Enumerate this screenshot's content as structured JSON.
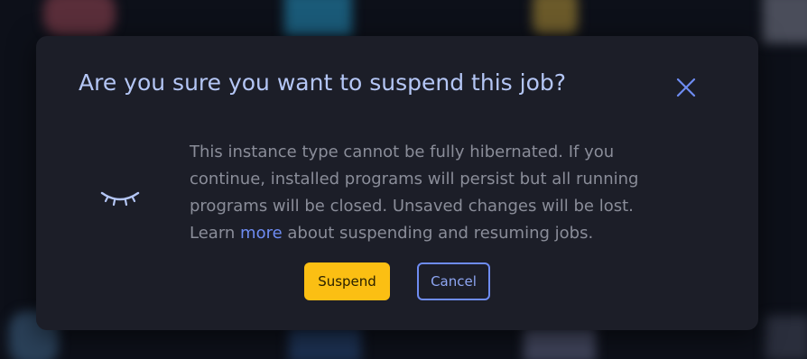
{
  "dialog": {
    "title": "Are you sure you want to suspend this job?",
    "close_icon": "close-icon",
    "illustration_icon": "closed-eye-icon",
    "message_pre": "This instance type cannot be fully hibernated. If you continue, installed programs will persist but all running programs will be closed. Unsaved changes will be lost. Learn ",
    "learn_more_link": "more",
    "message_post": " about suspending and resuming jobs.",
    "suspend_label": "Suspend",
    "cancel_label": "Cancel"
  },
  "colors": {
    "accent_yellow": "#fbbf13",
    "accent_blue": "#6e8cf2",
    "dialog_bg": "#1c1e28",
    "title_color": "#b4c6f5"
  }
}
